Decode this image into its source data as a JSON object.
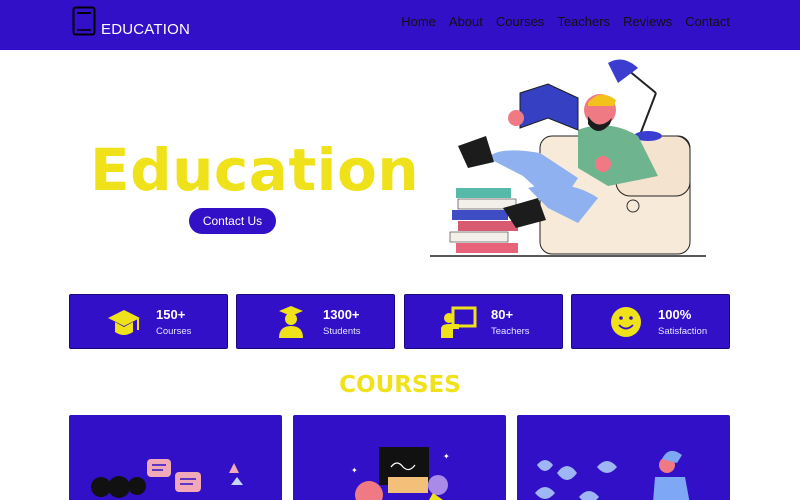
{
  "header": {
    "logo_text": "EDUCATION",
    "nav": [
      "Home",
      "About",
      "Courses",
      "Teachers",
      "Reviews",
      "Contact"
    ]
  },
  "hero": {
    "title": "Education",
    "button_label": "Contact Us"
  },
  "stats": [
    {
      "value": "150+",
      "label": "Courses",
      "icon": "graduation-cap-icon"
    },
    {
      "value": "1300+",
      "label": "Students",
      "icon": "student-icon"
    },
    {
      "value": "80+",
      "label": "Teachers",
      "icon": "teacher-icon"
    },
    {
      "value": "100%",
      "label": "Satisfaction",
      "icon": "smiley-icon"
    }
  ],
  "courses": {
    "title": "COURSES"
  },
  "colors": {
    "primary": "#3210c8",
    "accent": "#f0e21a",
    "white": "#ffffff"
  }
}
